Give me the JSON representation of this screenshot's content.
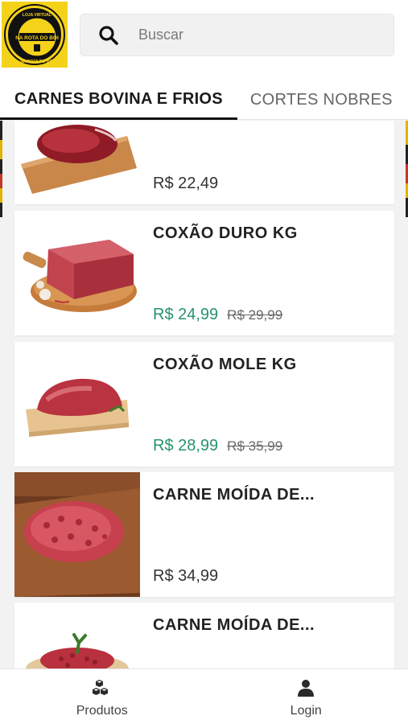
{
  "logo": {
    "text_top": "LOJA VIRTUAL NA ROTA DO BOI",
    "text_main": "NA ROTA DO BOI",
    "text_bottom": "NA ROTA DO BOI"
  },
  "search": {
    "placeholder": "Buscar"
  },
  "tabs": [
    {
      "label": "CARNES BOVINA E FRIOS",
      "active": true
    },
    {
      "label": "CORTES NOBRES",
      "active": false
    }
  ],
  "products": [
    {
      "name": "",
      "price": "R$ 22,49",
      "old_price": "",
      "image": "raw-beef-on-board"
    },
    {
      "name": "COXÃO DURO KG",
      "price": "R$ 24,99",
      "old_price": "R$ 29,99",
      "image": "raw-beef-on-round-board"
    },
    {
      "name": "COXÃO MOLE KG",
      "price": "R$ 28,99",
      "old_price": "R$ 35,99",
      "image": "raw-beef-on-board"
    },
    {
      "name": "CARNE MOÍDA DE...",
      "price": "R$ 34,99",
      "old_price": "",
      "image": "ground-beef-on-board"
    },
    {
      "name": "CARNE MOÍDA DE...",
      "price": "",
      "old_price": "",
      "image": "ground-beef-in-bowl"
    }
  ],
  "bottom_nav": [
    {
      "label": "Produtos",
      "icon": "cubes-icon"
    },
    {
      "label": "Login",
      "icon": "user-icon"
    }
  ],
  "colors": {
    "sale_price": "#27946b",
    "logo_bg": "#f4d21a"
  }
}
